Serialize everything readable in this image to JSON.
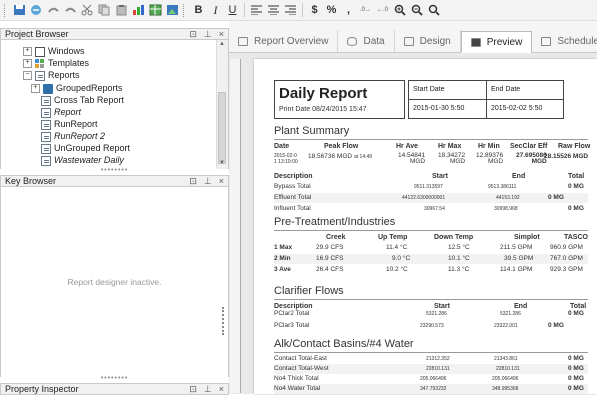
{
  "toolbar": {
    "buttons": [
      "save-report",
      "open-icons",
      "undo",
      "redo",
      "cut",
      "copy",
      "paste",
      "chart",
      "table",
      "image"
    ],
    "text_bold": "B",
    "text_italic": "I",
    "text_underline": "U",
    "currency": "$",
    "percent": "%",
    "comma": ",",
    "zoom_in": "+",
    "zoom_out": "−"
  },
  "project_browser": {
    "title": "Project Browser",
    "items": [
      {
        "label": "Windows",
        "icon": "window-icon",
        "level": 1,
        "expand": "+"
      },
      {
        "label": "Templates",
        "icon": "templates-icon",
        "level": 1,
        "expand": "+"
      },
      {
        "label": "Reports",
        "icon": "report-folder-icon",
        "level": 1,
        "expand": "−"
      },
      {
        "label": "GroupedReports",
        "icon": "folder-icon",
        "level": 2,
        "expand": "+"
      },
      {
        "label": "Cross Tab Report",
        "icon": "document-icon",
        "level": 2
      },
      {
        "label": "Report",
        "icon": "document-icon",
        "level": 2,
        "italic": true
      },
      {
        "label": "RunReport",
        "icon": "document-icon",
        "level": 2
      },
      {
        "label": "RunReport 2",
        "icon": "document-icon",
        "level": 2,
        "italic": true
      },
      {
        "label": "UnGrouped Report",
        "icon": "document-icon",
        "level": 2
      },
      {
        "label": "Wastewater Daily",
        "icon": "edit-document-icon",
        "level": 2,
        "italic": true
      }
    ]
  },
  "key_browser": {
    "title": "Key Browser",
    "message": "Report designer inactive."
  },
  "property_inspector": {
    "title": "Property Inspector"
  },
  "panel_controls": {
    "restore": "⊡",
    "pin": "⊥",
    "close": "×"
  },
  "tabs": [
    {
      "label": "Report Overview",
      "icon": "overview-icon"
    },
    {
      "label": "Data",
      "icon": "database-icon"
    },
    {
      "label": "Design",
      "icon": "design-icon"
    },
    {
      "label": "Preview",
      "icon": "preview-icon",
      "active": true
    },
    {
      "label": "Schedule",
      "icon": "schedule-icon"
    }
  ],
  "report": {
    "title": "Daily Report",
    "print_date": "Print Date 08/24/2015 15:47",
    "start_label": "Start Date",
    "end_label": "End Date",
    "start_value": "2015-01-30 5:50",
    "end_value": "2015-02-02 5:50",
    "plant_summary": {
      "title": "Plant Summary",
      "headers": [
        "Date",
        "Peak Flow",
        "Hr Ave",
        "Hr Max",
        "Hr Min",
        "SecClar Eff",
        "Raw Flow"
      ],
      "date_value": "2015-02-0\n1 13:19:00",
      "peak_flow": "18.56736 MGD",
      "peak_flow_time": "at 14:49",
      "hr_ave": "14.54841\nMGD",
      "hr_max": "18.34272\nMGD",
      "hr_min": "12.89376\nMGD",
      "secclar_eff": "27.695086\nMGD",
      "raw_flow": "28.15526 MGD",
      "desc_headers": [
        "Description",
        "Start",
        "End",
        "Total"
      ],
      "rows": [
        {
          "desc": "Bypass Total",
          "start": "9511.313597",
          "end": "9513.386111",
          "total": "0 MG"
        },
        {
          "desc": "Effluent Total",
          "start": "44122.6300000001",
          "end": "44153.192",
          "total": "0 MG"
        },
        {
          "desc": "Influent Total",
          "start": "30967.54",
          "end": "30998.968",
          "total": "0 MG"
        }
      ]
    },
    "pretreatment": {
      "title": "Pre-Treatment/Industries",
      "headers": [
        "Creek",
        "Up Temp",
        "Down Temp",
        "Simplot",
        "TASCO"
      ],
      "rows": [
        {
          "label": "1 Max",
          "creek": "29.9 CFS",
          "up": "11.4 °C",
          "down": "12.5 °C",
          "simplot": "211.5 GPM",
          "tasco": "960.9 GPM"
        },
        {
          "label": "2 Min",
          "creek": "16.9 CFS",
          "up": "9.0 °C",
          "down": "10.1 °C",
          "simplot": "39.5 GPM",
          "tasco": "767.0 GPM"
        },
        {
          "label": "3 Ave",
          "creek": "26.4 CFS",
          "up": "10.2 °C",
          "down": "11.3 °C",
          "simplot": "114.1 GPM",
          "tasco": "929.3 GPM"
        }
      ]
    },
    "clarifier": {
      "title": "Clarifier Flows",
      "headers": [
        "Description",
        "Start",
        "End",
        "Total"
      ],
      "rows": [
        {
          "desc": "PClar2 Total",
          "start": "5321.286",
          "end": "5321.286",
          "total": "0 MG"
        },
        {
          "desc": "PClar3 Total",
          "start": "23290.573",
          "end": "23322.001",
          "total": "0 MG"
        }
      ]
    },
    "alk": {
      "title": "Alk/Contact Basins/#4 Water",
      "rows": [
        {
          "desc": "Contact Total-East",
          "start": "21312.352",
          "end": "21343.861",
          "total": "0 MG"
        },
        {
          "desc": "Contact Total-West",
          "start": "22810.131",
          "end": "22810.131",
          "total": "0 MG"
        },
        {
          "desc": "No4 Thick Total",
          "start": "205.066496",
          "end": "205.066496",
          "total": "0 MG"
        },
        {
          "desc": "No4 Water Total",
          "start": "347.793232",
          "end": "348.995368",
          "total": "0 MG"
        }
      ]
    }
  }
}
